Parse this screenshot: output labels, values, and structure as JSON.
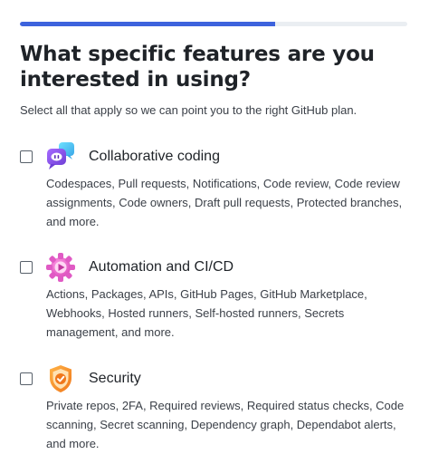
{
  "progress": {
    "fraction": 0.66,
    "color": "#3d63dd",
    "track_color": "#eaeef2"
  },
  "title": "What specific features are you interested in using?",
  "subtitle": "Select all that apply so we can point you to the right GitHub plan.",
  "options": [
    {
      "label": "Collaborative coding",
      "description": "Codespaces, Pull requests, Notifications, Code review, Code review assignments, Code owners, Draft pull requests, Protected branches, and more.",
      "icon": "chat-bubbles-icon",
      "checked": false
    },
    {
      "label": "Automation and CI/CD",
      "description": "Actions, Packages, APIs, GitHub Pages, GitHub Marketplace, Webhooks, Hosted runners, Self-hosted runners, Secrets management, and more.",
      "icon": "gear-play-icon",
      "checked": false
    },
    {
      "label": "Security",
      "description": "Private repos, 2FA, Required reviews, Required status checks, Code scanning, Secret scanning, Dependency graph, Dependabot alerts, and more.",
      "icon": "shield-check-icon",
      "checked": false
    }
  ]
}
